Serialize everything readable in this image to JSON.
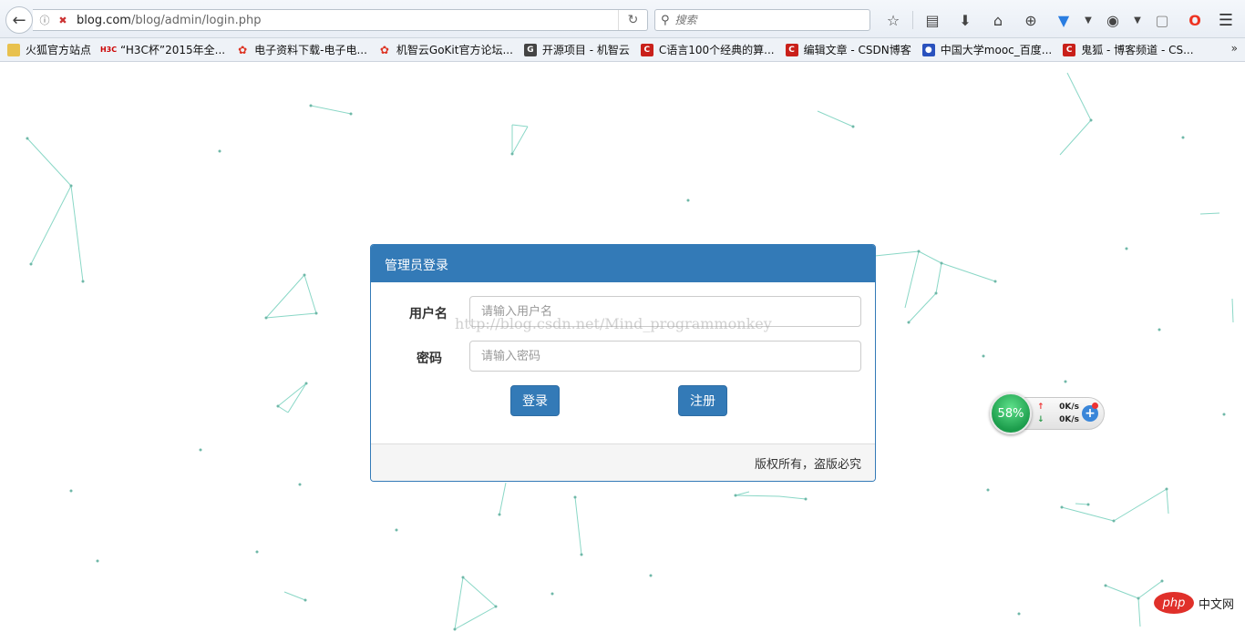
{
  "browser": {
    "url_host": "blog.com",
    "url_path": "/blog/admin/login.php",
    "search_placeholder": "搜索",
    "icons": {
      "back": "back-arrow-icon",
      "reload": "reload-icon",
      "search": "search-icon",
      "bookmark_star": "star-icon",
      "reading_list": "clipboard-icon",
      "download": "download-icon",
      "home": "home-icon",
      "addon": "target-icon",
      "download_manager": "download-manager-icon",
      "privacy": "eye-icon",
      "extension": "extension-icon",
      "opera": "opera-icon",
      "menu": "hamburger-menu-icon"
    }
  },
  "bookmarks": [
    {
      "label": "火狐官方站点",
      "icon": "folder-icon"
    },
    {
      "label": "“H3C杯”2015年全...",
      "icon": "h3c-icon"
    },
    {
      "label": "电子资料下载-电子电...",
      "icon": "fire-icon"
    },
    {
      "label": "机智云GoKit官方论坛...",
      "icon": "fire-icon"
    },
    {
      "label": "开源项目 - 机智云",
      "icon": "gitee-icon"
    },
    {
      "label": "C语言100个经典的算...",
      "icon": "csdn-icon"
    },
    {
      "label": "编辑文章 - CSDN博客",
      "icon": "csdn-icon"
    },
    {
      "label": "中国大学mooc_百度...",
      "icon": "baidu-paw-icon"
    },
    {
      "label": "鬼狐 - 博客频道 - CS...",
      "icon": "csdn-icon"
    }
  ],
  "login": {
    "title": "管理员登录",
    "username_label": "用户名",
    "username_placeholder": "请输入用户名",
    "password_label": "密码",
    "password_placeholder": "请输入密码",
    "login_button": "登录",
    "register_button": "注册",
    "footer": "版权所有，盗版必究",
    "watermark": "http://blog.csdn.net/Mind_programmonkey"
  },
  "speed_widget": {
    "percent": "58%",
    "up": "0K/s",
    "down": "0K/s"
  },
  "site_badge": {
    "logo": "php",
    "text": "中文网"
  },
  "colors": {
    "primary": "#337ab7",
    "network_lines": "#7dd3c0"
  }
}
